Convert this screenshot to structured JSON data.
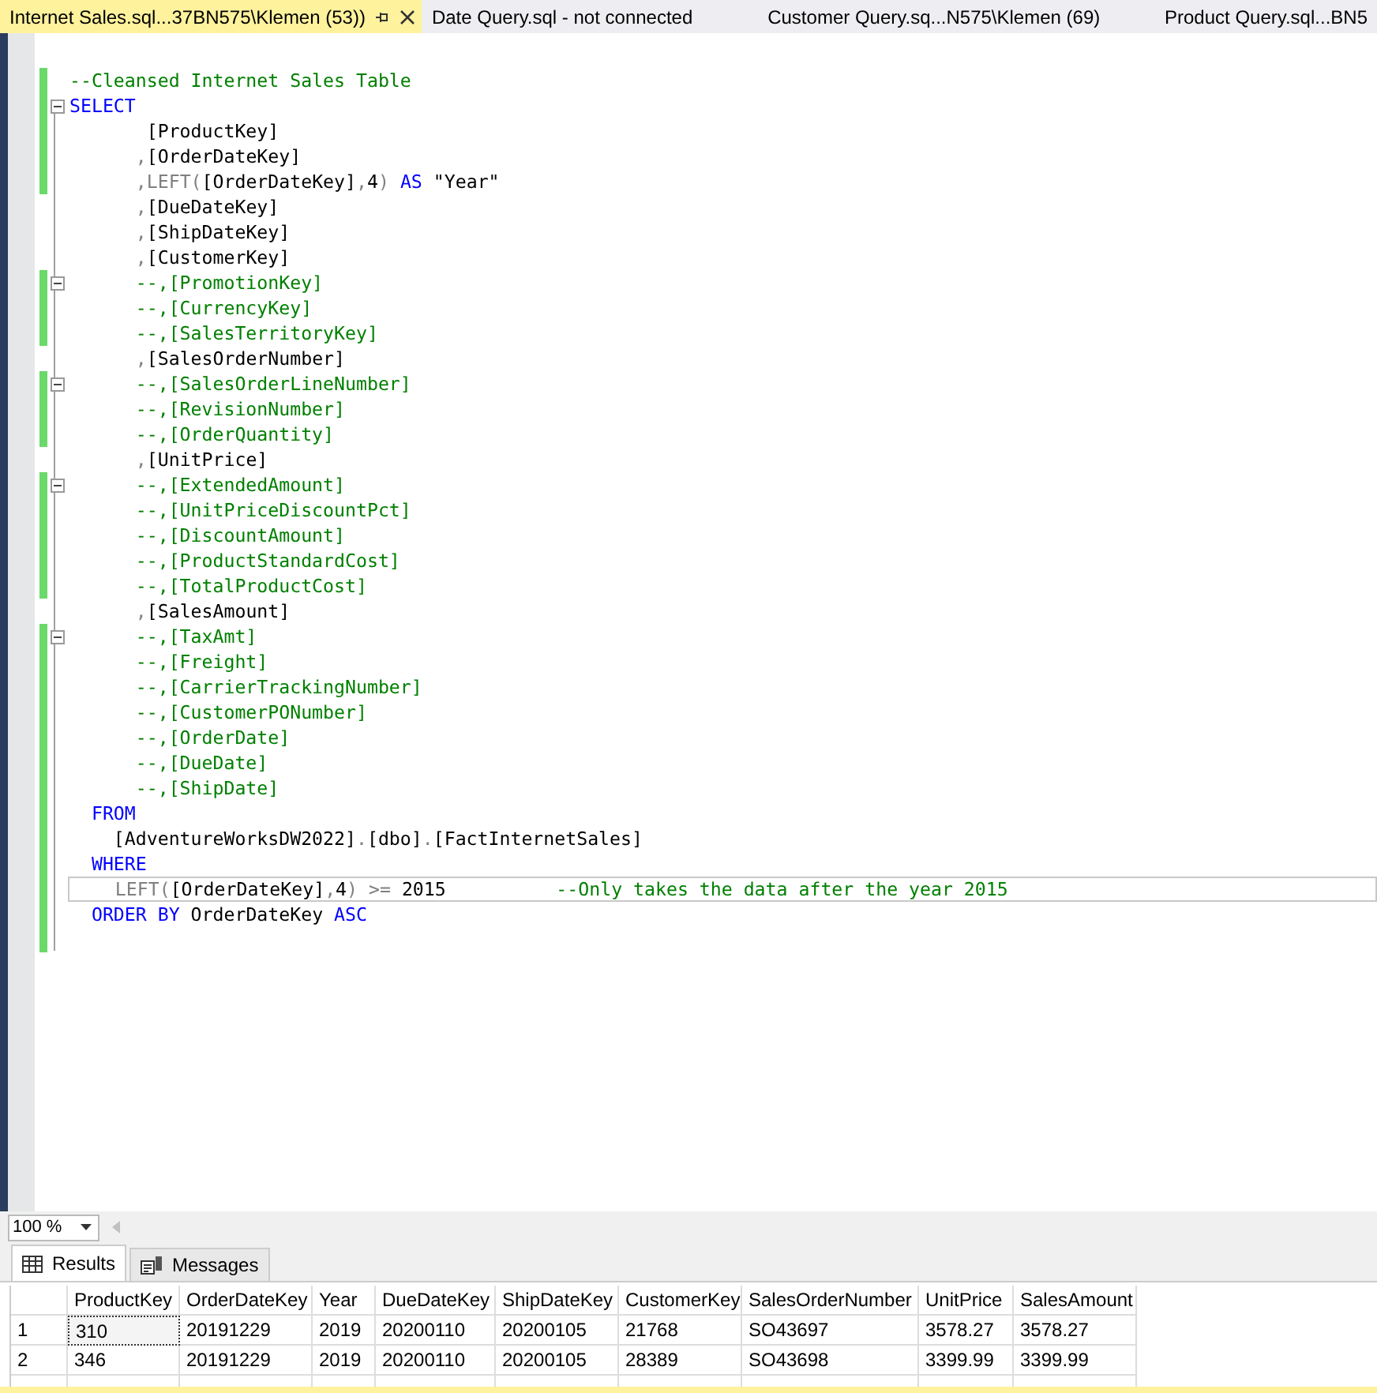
{
  "tabs": [
    {
      "label": "Internet Sales.sql...37BN575\\Klemen (53))",
      "selected": true
    },
    {
      "label": "Date Query.sql - not connected",
      "selected": false
    },
    {
      "label": "Customer Query.sq...N575\\Klemen (69)",
      "selected": false
    },
    {
      "label": "Product Query.sql...BN5",
      "selected": false
    }
  ],
  "editor": {
    "lines": [
      {
        "changed": true,
        "fold": false,
        "current": false,
        "tokens": [
          {
            "kind": "comment",
            "text": "--Cleansed Internet Sales Table"
          }
        ]
      },
      {
        "changed": true,
        "fold": true,
        "current": false,
        "tokens": [
          {
            "kind": "keyword",
            "text": "SELECT"
          }
        ]
      },
      {
        "changed": true,
        "fold": false,
        "current": false,
        "tokens": [
          {
            "kind": "ident",
            "text": "       [ProductKey]"
          }
        ]
      },
      {
        "changed": true,
        "fold": false,
        "current": false,
        "tokens": [
          {
            "kind": "punct",
            "text": "      ,"
          },
          {
            "kind": "ident",
            "text": "[OrderDateKey]"
          }
        ]
      },
      {
        "changed": true,
        "fold": false,
        "current": false,
        "tokens": [
          {
            "kind": "punct",
            "text": "      ,"
          },
          {
            "kind": "func",
            "text": "LEFT"
          },
          {
            "kind": "punct",
            "text": "("
          },
          {
            "kind": "ident",
            "text": "[OrderDateKey]"
          },
          {
            "kind": "punct",
            "text": ","
          },
          {
            "kind": "ident",
            "text": "4"
          },
          {
            "kind": "punct",
            "text": ")"
          },
          {
            "kind": "keyword",
            "text": " AS"
          },
          {
            "kind": "ident",
            "text": " \"Year\""
          }
        ]
      },
      {
        "changed": false,
        "fold": false,
        "current": false,
        "tokens": [
          {
            "kind": "punct",
            "text": "      ,"
          },
          {
            "kind": "ident",
            "text": "[DueDateKey]"
          }
        ]
      },
      {
        "changed": false,
        "fold": false,
        "current": false,
        "tokens": [
          {
            "kind": "punct",
            "text": "      ,"
          },
          {
            "kind": "ident",
            "text": "[ShipDateKey]"
          }
        ]
      },
      {
        "changed": false,
        "fold": false,
        "current": false,
        "tokens": [
          {
            "kind": "punct",
            "text": "      ,"
          },
          {
            "kind": "ident",
            "text": "[CustomerKey]"
          }
        ]
      },
      {
        "changed": true,
        "fold": true,
        "current": false,
        "tokens": [
          {
            "kind": "comment",
            "text": "      --,[PromotionKey]"
          }
        ]
      },
      {
        "changed": true,
        "fold": false,
        "current": false,
        "tokens": [
          {
            "kind": "comment",
            "text": "      --,[CurrencyKey]"
          }
        ]
      },
      {
        "changed": true,
        "fold": false,
        "current": false,
        "tokens": [
          {
            "kind": "comment",
            "text": "      --,[SalesTerritoryKey]"
          }
        ]
      },
      {
        "changed": false,
        "fold": false,
        "current": false,
        "tokens": [
          {
            "kind": "punct",
            "text": "      ,"
          },
          {
            "kind": "ident",
            "text": "[SalesOrderNumber]"
          }
        ]
      },
      {
        "changed": true,
        "fold": true,
        "current": false,
        "tokens": [
          {
            "kind": "comment",
            "text": "      --,[SalesOrderLineNumber]"
          }
        ]
      },
      {
        "changed": true,
        "fold": false,
        "current": false,
        "tokens": [
          {
            "kind": "comment",
            "text": "      --,[RevisionNumber]"
          }
        ]
      },
      {
        "changed": true,
        "fold": false,
        "current": false,
        "tokens": [
          {
            "kind": "comment",
            "text": "      --,[OrderQuantity]"
          }
        ]
      },
      {
        "changed": false,
        "fold": false,
        "current": false,
        "tokens": [
          {
            "kind": "punct",
            "text": "      ,"
          },
          {
            "kind": "ident",
            "text": "[UnitPrice]"
          }
        ]
      },
      {
        "changed": true,
        "fold": true,
        "current": false,
        "tokens": [
          {
            "kind": "comment",
            "text": "      --,[ExtendedAmount]"
          }
        ]
      },
      {
        "changed": true,
        "fold": false,
        "current": false,
        "tokens": [
          {
            "kind": "comment",
            "text": "      --,[UnitPriceDiscountPct]"
          }
        ]
      },
      {
        "changed": true,
        "fold": false,
        "current": false,
        "tokens": [
          {
            "kind": "comment",
            "text": "      --,[DiscountAmount]"
          }
        ]
      },
      {
        "changed": true,
        "fold": false,
        "current": false,
        "tokens": [
          {
            "kind": "comment",
            "text": "      --,[ProductStandardCost]"
          }
        ]
      },
      {
        "changed": true,
        "fold": false,
        "current": false,
        "tokens": [
          {
            "kind": "comment",
            "text": "      --,[TotalProductCost]"
          }
        ]
      },
      {
        "changed": false,
        "fold": false,
        "current": false,
        "tokens": [
          {
            "kind": "punct",
            "text": "      ,"
          },
          {
            "kind": "ident",
            "text": "[SalesAmount]"
          }
        ]
      },
      {
        "changed": true,
        "fold": true,
        "current": false,
        "tokens": [
          {
            "kind": "comment",
            "text": "      --,[TaxAmt]"
          }
        ]
      },
      {
        "changed": true,
        "fold": false,
        "current": false,
        "tokens": [
          {
            "kind": "comment",
            "text": "      --,[Freight]"
          }
        ]
      },
      {
        "changed": true,
        "fold": false,
        "current": false,
        "tokens": [
          {
            "kind": "comment",
            "text": "      --,[CarrierTrackingNumber]"
          }
        ]
      },
      {
        "changed": true,
        "fold": false,
        "current": false,
        "tokens": [
          {
            "kind": "comment",
            "text": "      --,[CustomerPONumber]"
          }
        ]
      },
      {
        "changed": true,
        "fold": false,
        "current": false,
        "tokens": [
          {
            "kind": "comment",
            "text": "      --,[OrderDate]"
          }
        ]
      },
      {
        "changed": true,
        "fold": false,
        "current": false,
        "tokens": [
          {
            "kind": "comment",
            "text": "      --,[DueDate]"
          }
        ]
      },
      {
        "changed": true,
        "fold": false,
        "current": false,
        "tokens": [
          {
            "kind": "comment",
            "text": "      --,[ShipDate]"
          }
        ]
      },
      {
        "changed": true,
        "fold": false,
        "current": false,
        "tokens": [
          {
            "kind": "keyword",
            "text": "  FROM"
          }
        ]
      },
      {
        "changed": true,
        "fold": false,
        "current": false,
        "tokens": [
          {
            "kind": "ident",
            "text": "    [AdventureWorksDW2022]"
          },
          {
            "kind": "punct",
            "text": "."
          },
          {
            "kind": "ident",
            "text": "[dbo]"
          },
          {
            "kind": "punct",
            "text": "."
          },
          {
            "kind": "ident",
            "text": "[FactInternetSales]"
          }
        ]
      },
      {
        "changed": true,
        "fold": false,
        "current": false,
        "tokens": [
          {
            "kind": "keyword",
            "text": "  WHERE"
          }
        ]
      },
      {
        "changed": true,
        "fold": false,
        "current": true,
        "tokens": [
          {
            "kind": "func",
            "text": "    LEFT"
          },
          {
            "kind": "punct",
            "text": "("
          },
          {
            "kind": "ident",
            "text": "[OrderDateKey]"
          },
          {
            "kind": "punct",
            "text": ","
          },
          {
            "kind": "ident",
            "text": "4"
          },
          {
            "kind": "punct",
            "text": ")"
          },
          {
            "kind": "punct",
            "text": " >="
          },
          {
            "kind": "ident",
            "text": " 2015          "
          },
          {
            "kind": "comment",
            "text": "--Only takes the data after the year 2015"
          }
        ]
      },
      {
        "changed": true,
        "fold": false,
        "current": false,
        "tokens": [
          {
            "kind": "keyword",
            "text": "  ORDER BY"
          },
          {
            "kind": "ident",
            "text": " OrderDateKey "
          },
          {
            "kind": "keyword",
            "text": "ASC"
          }
        ]
      },
      {
        "changed": true,
        "fold": false
      }
    ]
  },
  "zoom": {
    "value": "100 %"
  },
  "result_tabs": [
    {
      "label": "Results",
      "selected": true
    },
    {
      "label": "Messages",
      "selected": false
    }
  ],
  "grid": {
    "columns": [
      "ProductKey",
      "OrderDateKey",
      "Year",
      "DueDateKey",
      "ShipDateKey",
      "CustomerKey",
      "SalesOrderNumber",
      "UnitPrice",
      "SalesAmount"
    ],
    "rows": [
      {
        "number": "1",
        "cells": [
          {
            "text": "310",
            "selected": true
          },
          {
            "text": "20191229",
            "selected": false
          },
          {
            "text": "2019",
            "selected": false
          },
          {
            "text": "20200110",
            "selected": false
          },
          {
            "text": "20200105",
            "selected": false
          },
          {
            "text": "21768",
            "selected": false
          },
          {
            "text": "SO43697",
            "selected": false
          },
          {
            "text": "3578.27",
            "selected": false
          },
          {
            "text": "3578.27",
            "selected": false
          }
        ]
      },
      {
        "number": "2",
        "cells": [
          {
            "text": "346",
            "selected": false
          },
          {
            "text": "20191229",
            "selected": false
          },
          {
            "text": "2019",
            "selected": false
          },
          {
            "text": "20200110",
            "selected": false
          },
          {
            "text": "20200105",
            "selected": false
          },
          {
            "text": "28389",
            "selected": false
          },
          {
            "text": "SO43698",
            "selected": false
          },
          {
            "text": "3399.99",
            "selected": false
          },
          {
            "text": "3399.99",
            "selected": false
          }
        ]
      }
    ]
  }
}
